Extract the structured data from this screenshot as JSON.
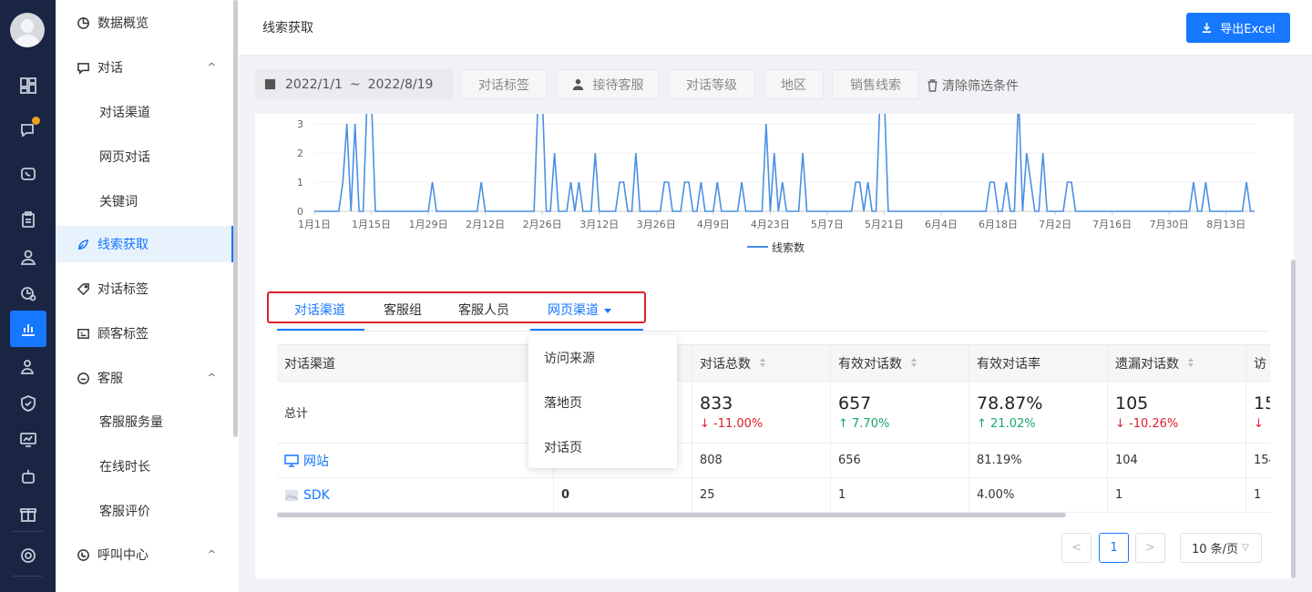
{
  "header": {
    "title": "线索获取",
    "export_label": "导出Excel"
  },
  "filters": {
    "date_start": "2022/1/1",
    "date_sep": "~",
    "date_end": "2022/8/19",
    "tag": "对话标签",
    "agent": "接待客服",
    "level": "对话等级",
    "region": "地区",
    "sales_lead": "销售线索",
    "clear": "清除筛选条件"
  },
  "sidebar": {
    "items": [
      {
        "label": "数据概览",
        "icon": "pie-icon"
      },
      {
        "label": "对话",
        "icon": "chat-icon",
        "arrow": "^"
      },
      {
        "label": "对话渠道"
      },
      {
        "label": "网页对话"
      },
      {
        "label": "关键词"
      },
      {
        "label": "线索获取",
        "icon": "lead-icon",
        "active": true
      },
      {
        "label": "对话标签",
        "icon": "tag-icon"
      },
      {
        "label": "顾客标签",
        "icon": "card-icon"
      },
      {
        "label": "客服",
        "icon": "service-icon",
        "arrow": "^"
      },
      {
        "label": "客服服务量"
      },
      {
        "label": "在线时长"
      },
      {
        "label": "客服评价"
      },
      {
        "label": "呼叫中心",
        "icon": "phone-icon",
        "arrow": "^"
      }
    ]
  },
  "rail": {
    "icons": [
      "dashboard-icon",
      "chat-bubbles-icon",
      "phone-chat-icon",
      "clipboard-icon",
      "user-icon",
      "analytics-icon",
      "bar-chart-icon",
      "team-icon",
      "shield-icon",
      "monitor-icon",
      "robot-icon",
      "gift-icon",
      "settings-icon"
    ]
  },
  "chart_data": {
    "type": "line",
    "series": [
      {
        "name": "线索数",
        "color": "#4a90e2"
      }
    ],
    "x_ticks": [
      "1月1日",
      "1月15日",
      "1月29日",
      "2月12日",
      "2月26日",
      "3月12日",
      "3月26日",
      "4月9日",
      "4月23日",
      "5月7日",
      "5月21日",
      "6月4日",
      "6月18日",
      "7月2日",
      "7月16日",
      "7月30日",
      "8月13日"
    ],
    "y_ticks": [
      "0",
      "1",
      "2",
      "3"
    ],
    "ylim": [
      0,
      3
    ],
    "x_days": 231,
    "spikes": [
      [
        7,
        1
      ],
      [
        8,
        3
      ],
      [
        10,
        3
      ],
      [
        13,
        4
      ],
      [
        14,
        4
      ],
      [
        29,
        1
      ],
      [
        41,
        1
      ],
      [
        55,
        4
      ],
      [
        56,
        4
      ],
      [
        59,
        2
      ],
      [
        63,
        1
      ],
      [
        65,
        1
      ],
      [
        69,
        2
      ],
      [
        75,
        1
      ],
      [
        76,
        1
      ],
      [
        79,
        2
      ],
      [
        86,
        1
      ],
      [
        87,
        1
      ],
      [
        91,
        1
      ],
      [
        92,
        1
      ],
      [
        95,
        1
      ],
      [
        99,
        1
      ],
      [
        105,
        1
      ],
      [
        111,
        3
      ],
      [
        113,
        2
      ],
      [
        115,
        1
      ],
      [
        120,
        2
      ],
      [
        133,
        1
      ],
      [
        134,
        1
      ],
      [
        136,
        1
      ],
      [
        139,
        4
      ],
      [
        140,
        4
      ],
      [
        166,
        1
      ],
      [
        167,
        1
      ],
      [
        170,
        1
      ],
      [
        173,
        4
      ],
      [
        175,
        2
      ],
      [
        176,
        1
      ],
      [
        179,
        2
      ],
      [
        185,
        1
      ],
      [
        186,
        1
      ],
      [
        216,
        1
      ],
      [
        219,
        1
      ],
      [
        229,
        1
      ]
    ]
  },
  "tabs": {
    "items": [
      "对话渠道",
      "客服组",
      "客服人员",
      "网页渠道"
    ],
    "dropdown": [
      "访问来源",
      "落地页",
      "对话页"
    ]
  },
  "table": {
    "headers": [
      "对话渠道",
      "",
      "对话总数",
      "有效对话数",
      "有效对话率",
      "遗漏对话数",
      "访"
    ],
    "total": {
      "label": "总计",
      "values": [
        "833",
        "657",
        "78.87%",
        "105",
        "15"
      ],
      "changes": [
        "↓ -11.00%",
        "↑ 7.70%",
        "↑ 21.02%",
        "↓ -10.26%",
        "↓"
      ]
    },
    "rows": [
      {
        "label": "网站",
        "c2": "",
        "values": [
          "808",
          "656",
          "81.19%",
          "104",
          "154"
        ]
      },
      {
        "label": "SDK",
        "c2": "0",
        "values": [
          "25",
          "1",
          "4.00%",
          "1",
          "1"
        ]
      }
    ]
  },
  "pagination": {
    "prev": "<",
    "page": "1",
    "next": ">",
    "page_size": "10 条/页"
  },
  "colors": {
    "accent": "#1677ff",
    "rail_bg": "#1a2543",
    "highlight_border": "#e0202a"
  }
}
